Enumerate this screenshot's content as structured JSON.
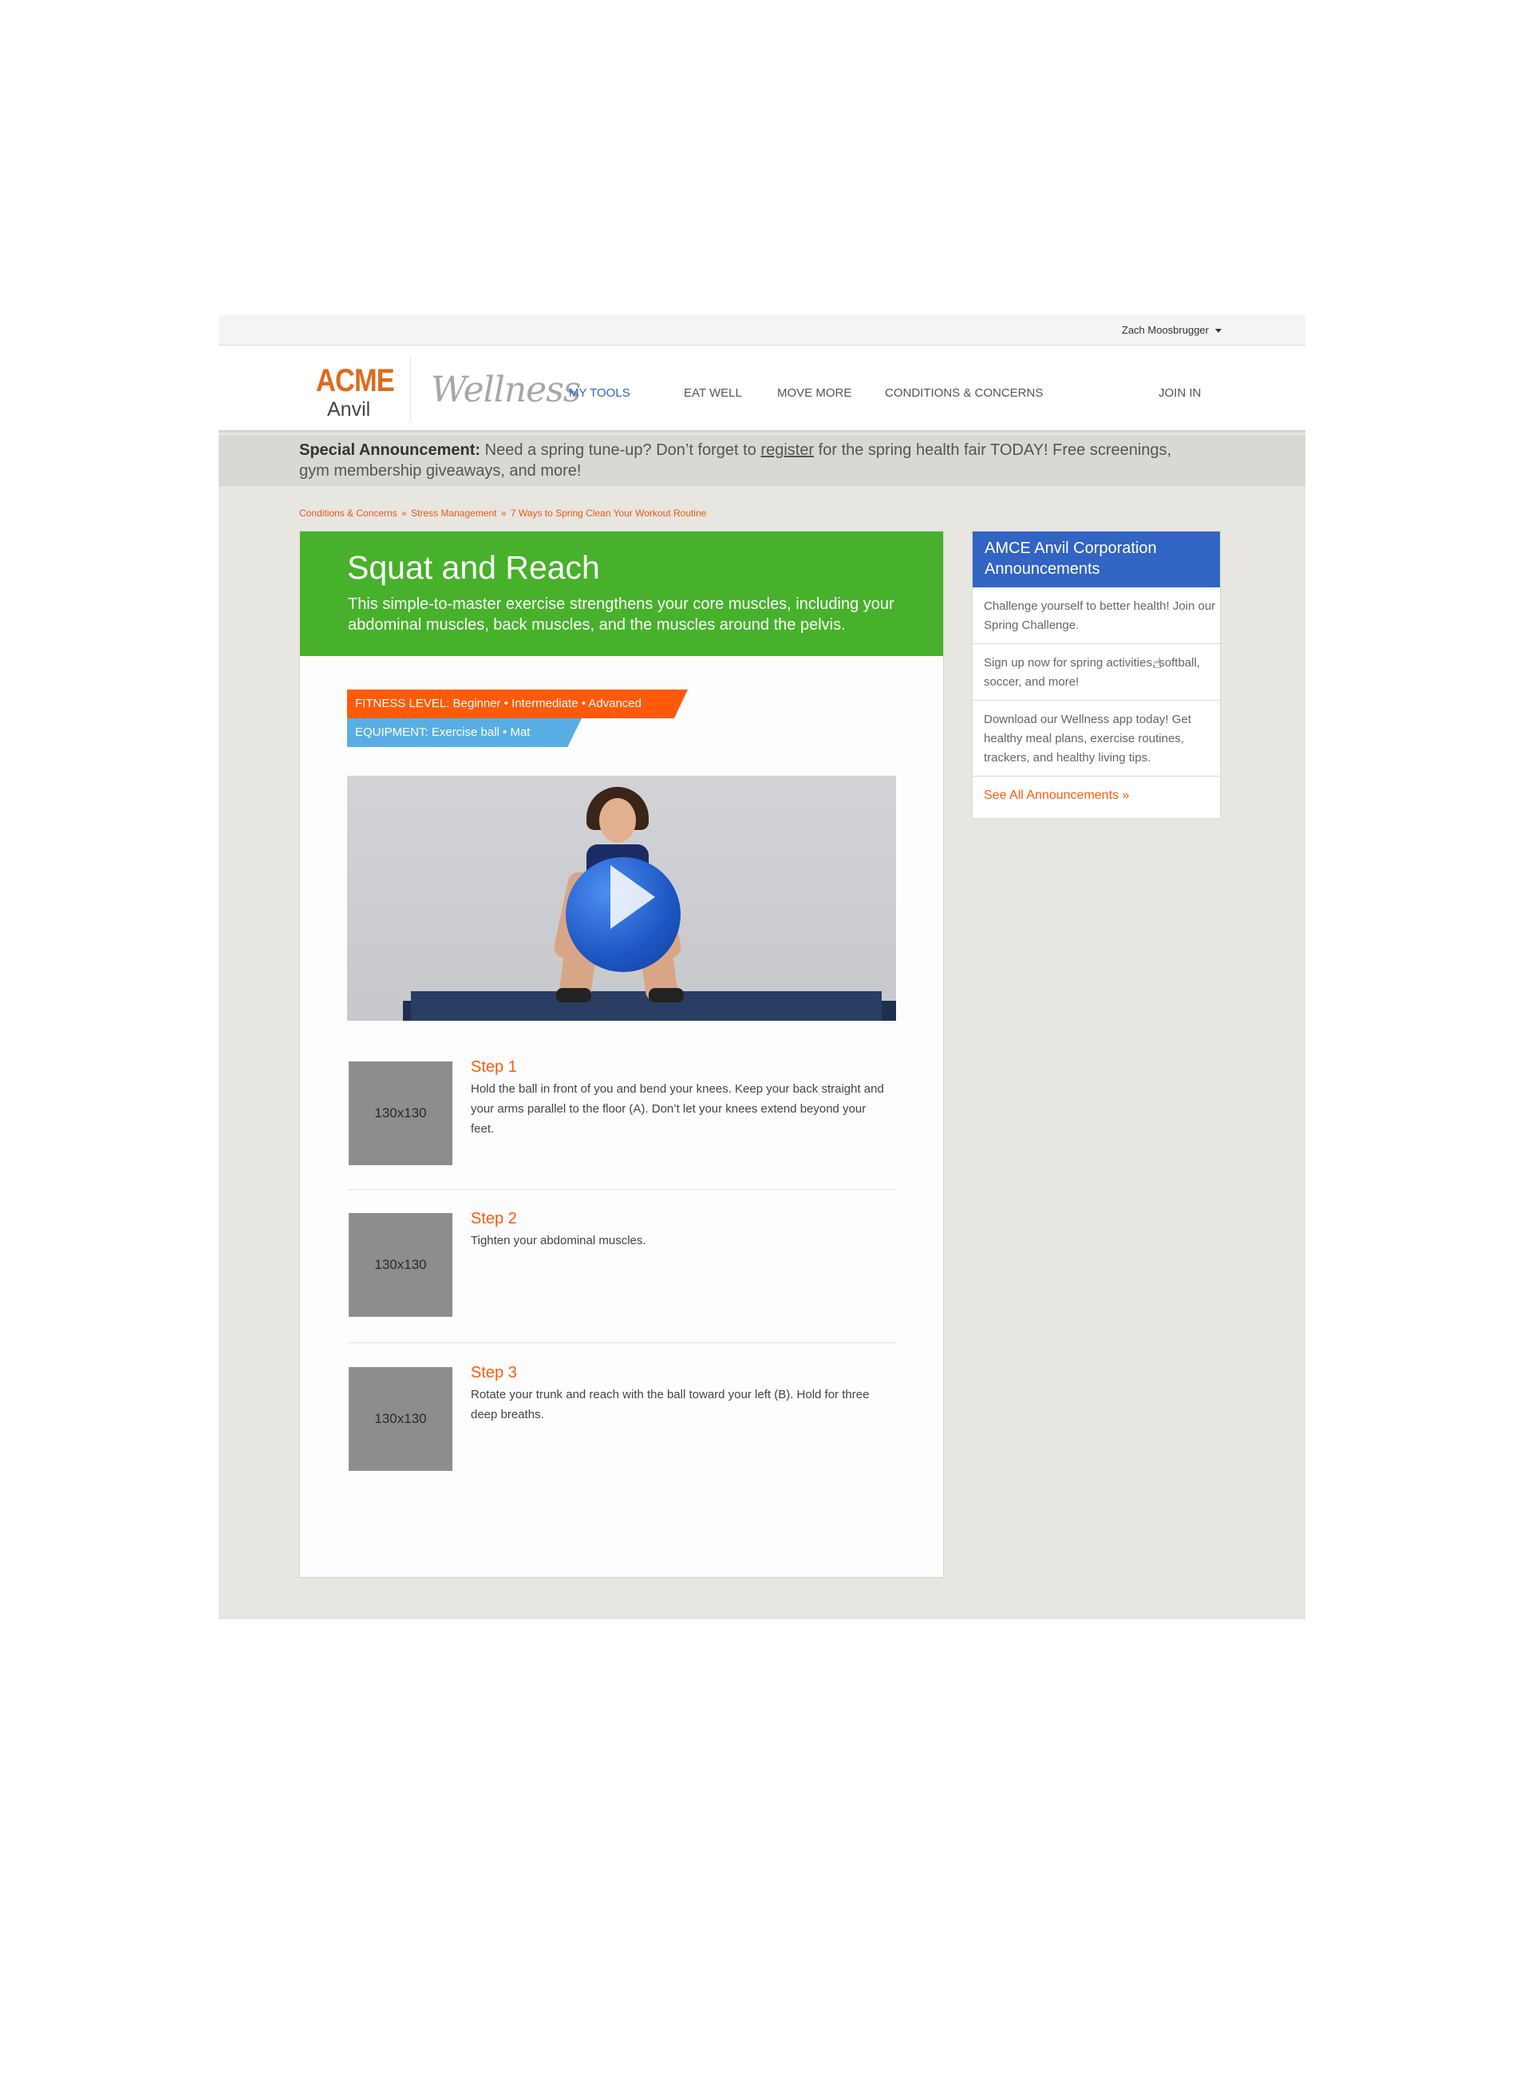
{
  "user": {
    "name": "Zach Moosbrugger"
  },
  "logo": {
    "brand": "ACME",
    "sub": "Anvil",
    "product": "Wellness"
  },
  "nav": {
    "items": [
      {
        "label": "MY TOOLS",
        "active": true
      },
      {
        "label": "EAT WELL"
      },
      {
        "label": "MOVE MORE"
      },
      {
        "label": "CONDITIONS & CONCERNS"
      },
      {
        "label": "JOIN IN"
      }
    ]
  },
  "announcement": {
    "lead": "Special Announcement:",
    "text1": " Need a spring tune-up? Don’t forget to ",
    "link": "register",
    "text2": " for the spring health fair TODAY! Free screenings, gym membership giveaways, and more!"
  },
  "breadcrumb": {
    "items": [
      "Conditions & Concerns",
      "Stress Management",
      "7 Ways to Spring Clean Your Workout Routine"
    ],
    "separator": "»"
  },
  "exercise": {
    "title": "Squat and Reach",
    "description": "This simple-to-master exercise strengthens your core muscles, including your abdominal muscles, back muscles, and the muscles around the pelvis.",
    "fitness_level": "FITNESS LEVEL: Beginner • Intermediate • Advanced",
    "equipment": "EQUIPMENT:  Exercise ball • Mat",
    "steps": [
      {
        "title": "Step 1",
        "thumb": "130x130",
        "text": "Hold the ball in front of you and bend your knees. Keep your back straight and your arms parallel to the floor (A). Don’t let your knees extend beyond your feet."
      },
      {
        "title": "Step 2",
        "thumb": "130x130",
        "text": "Tighten your abdominal muscles."
      },
      {
        "title": "Step 3",
        "thumb": "130x130",
        "text": "Rotate your trunk and reach with the ball toward your left (B). Hold for three deep breaths."
      }
    ]
  },
  "sidebar": {
    "title": "AMCE Anvil Corporation Announcements",
    "items": [
      "Challenge yourself to better health! Join our Spring Challenge.",
      "Sign up now for spring activities, softball, soccer, and more!",
      "Download our Wellness app today! Get healthy meal plans, exercise routines, trackers, and healthy living tips."
    ],
    "link": "See All Announcements »"
  },
  "colors": {
    "brand_orange": "#e06a1d",
    "accent_orange": "#ff5a0a",
    "hero_green": "#47b12b",
    "sidebar_blue": "#3164c3",
    "tag_blue": "#58aee4"
  }
}
